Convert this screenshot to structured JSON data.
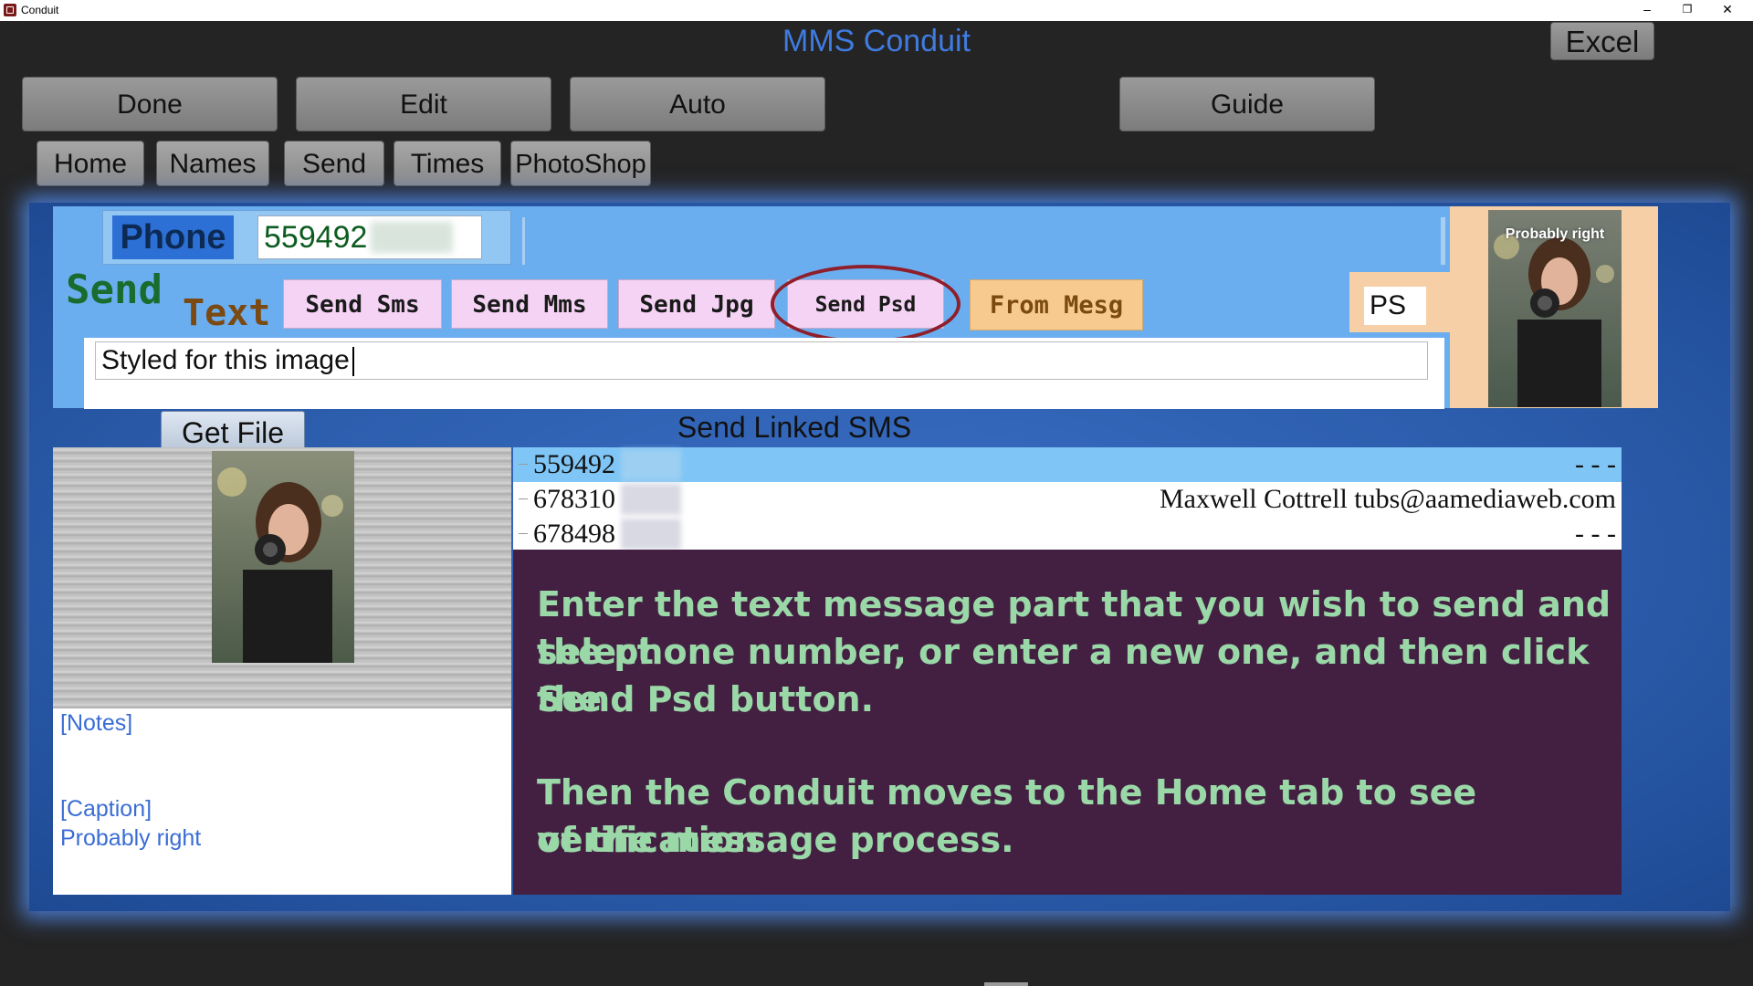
{
  "window": {
    "title": "Conduit",
    "minimize": "–",
    "restore": "❐",
    "close": "✕"
  },
  "header": {
    "title": "MMS Conduit",
    "excel_label": "Excel"
  },
  "main_buttons": {
    "done": "Done",
    "edit": "Edit",
    "auto": "Auto",
    "guide": "Guide"
  },
  "tabs": {
    "home": "Home",
    "names": "Names",
    "send": "Send",
    "times": "Times",
    "photoshop": "PhotoShop"
  },
  "phone": {
    "label": "Phone",
    "value": "559492"
  },
  "send_section": {
    "send_label": "Send",
    "text_label": "Text",
    "buttons": {
      "sms": "Send Sms",
      "mms": "Send Mms",
      "jpg": "Send Jpg",
      "psd": "Send Psd",
      "from_mesg": "From Mesg"
    },
    "ps_value": "PS",
    "message_value": "Styled for this image",
    "thumbnail_caption": "Probably right"
  },
  "files": {
    "get_file_label": "Get File",
    "linked_title": "Send Linked SMS"
  },
  "phone_list": [
    {
      "number": "678310",
      "right": "Maxwell Cottrell tubs@aamediaweb.com"
    },
    {
      "number": "678498",
      "right": "- - -"
    }
  ],
  "phone_list_selected": {
    "number": "559492",
    "right": "- - -"
  },
  "notes": {
    "notes_label": "[Notes]",
    "caption_label": "[Caption]",
    "caption_value": "Probably right"
  },
  "info": {
    "line1": "Enter the text message part that you wish to send and select",
    "line2": "the phone number, or enter a new one, and then click the",
    "line3": "Send Psd button.",
    "line4": "Then the Conduit moves to the Home tab to see verification",
    "line5": "of the message process."
  },
  "colors": {
    "accent_blue": "#3f7be0",
    "panel_blue": "#6aaef0",
    "info_bg": "#432042",
    "info_text": "#9ad8a8",
    "highlight_ellipse": "#8e1f2b"
  }
}
